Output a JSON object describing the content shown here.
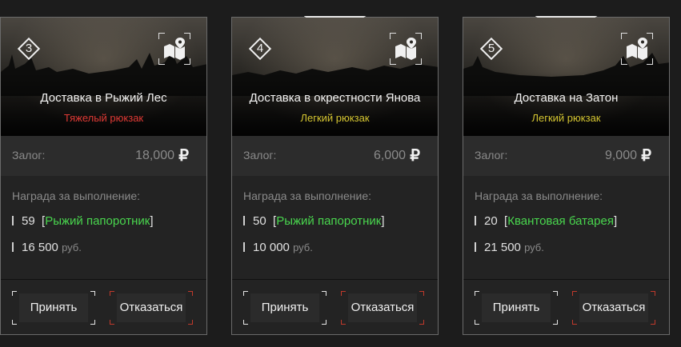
{
  "labels": {
    "deposit": "Залог:",
    "reward_header": "Награда за выполнение:",
    "currency_symbol": "₽",
    "rub_unit": "руб.",
    "accept": "Принять",
    "decline": "Отказаться"
  },
  "colors": {
    "heavy": "#e03a35",
    "light": "#d4c531",
    "item": "#49d64e"
  },
  "cards": [
    {
      "number": "3",
      "title": "Доставка в Рыжий Лес",
      "backpack": "Тяжелый рюкзак",
      "backpack_type": "heavy",
      "deposit": "18,000",
      "reward_qty": "59",
      "reward_item": "Рыжий папоротник",
      "reward_money": "16 500"
    },
    {
      "number": "4",
      "title": "Доставка в окрестности Янова",
      "backpack": "Легкий рюкзак",
      "backpack_type": "light",
      "deposit": "6,000",
      "reward_qty": "50",
      "reward_item": "Рыжий папоротник",
      "reward_money": "10 000"
    },
    {
      "number": "5",
      "title": "Доставка на Затон",
      "backpack": "Легкий рюкзак",
      "backpack_type": "light",
      "deposit": "9,000",
      "reward_qty": "20",
      "reward_item": "Квантовая батарея",
      "reward_money": "21 500"
    }
  ]
}
